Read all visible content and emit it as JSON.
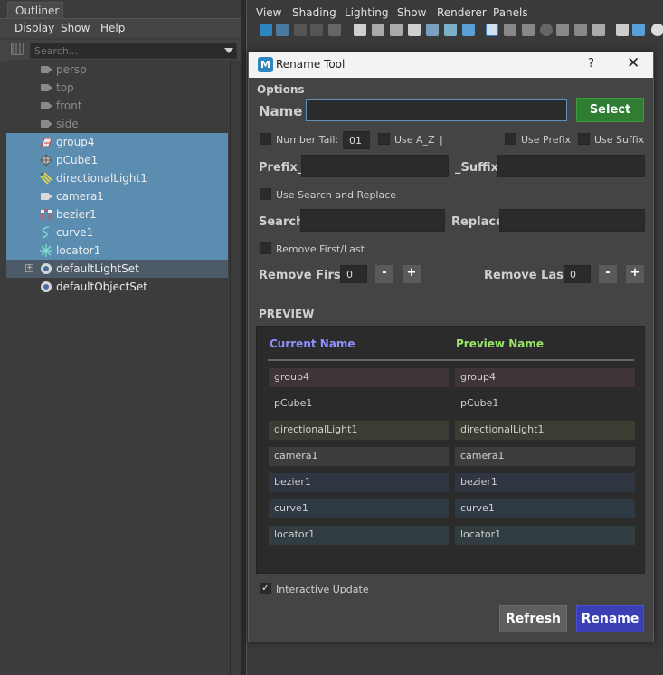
{
  "outliner": {
    "tab_label": "Outliner",
    "menu": [
      "Display",
      "Show",
      "Help"
    ],
    "search_placeholder": "Search...",
    "items": [
      {
        "label": "persp",
        "type": "camera"
      },
      {
        "label": "top",
        "type": "camera"
      },
      {
        "label": "front",
        "type": "camera"
      },
      {
        "label": "side",
        "type": "camera"
      },
      {
        "label": "group4",
        "type": "group"
      },
      {
        "label": "pCube1",
        "type": "mesh"
      },
      {
        "label": "directionalLight1",
        "type": "light"
      },
      {
        "label": "camera1",
        "type": "camera-user"
      },
      {
        "label": "bezier1",
        "type": "bezier"
      },
      {
        "label": "curve1",
        "type": "curve"
      },
      {
        "label": "locator1",
        "type": "locator"
      },
      {
        "label": "defaultLightSet",
        "type": "set"
      },
      {
        "label": "defaultObjectSet",
        "type": "set"
      }
    ]
  },
  "viewport": {
    "menu": [
      "View",
      "Shading",
      "Lighting",
      "Show",
      "Renderer",
      "Panels"
    ]
  },
  "dialog": {
    "title": "Rename Tool",
    "help": "?",
    "close": "✕",
    "options_label": "Options",
    "name_label": "Name",
    "name_value": "",
    "select_button": "Select",
    "number_tail_label": "Number Tail:",
    "number_tail_value": "01",
    "use_az_label": "Use A_Z",
    "separator": "|",
    "use_prefix_label": "Use Prefix",
    "use_suffix_label": "Use Suffix",
    "prefix_label": "Prefix_",
    "suffix_label": "_Suffix",
    "use_search_replace_label": "Use Search and Replace",
    "search_label": "Search",
    "replace_label": "Replace",
    "remove_first_last_label": "Remove First/Last",
    "remove_first_label": "Remove First:",
    "remove_first_value": "0",
    "remove_last_label": "Remove Last:",
    "remove_last_value": "0",
    "minus": "-",
    "plus": "+",
    "preview_label": "PREVIEW",
    "current_name_header": "Current Name",
    "preview_name_header": "Preview Name",
    "rows": [
      {
        "current": "group4",
        "preview": "group4",
        "color": "#3f3538"
      },
      {
        "current": "pCube1",
        "preview": "pCube1",
        "color": "#2b2b2b"
      },
      {
        "current": "directionalLight1",
        "preview": "directionalLight1",
        "color": "#3c3d32"
      },
      {
        "current": "camera1",
        "preview": "camera1",
        "color": "#3d3d3d"
      },
      {
        "current": "bezier1",
        "preview": "bezier1",
        "color": "#2f3641"
      },
      {
        "current": "curve1",
        "preview": "curve1",
        "color": "#2f3944"
      },
      {
        "current": "locator1",
        "preview": "locator1",
        "color": "#313d40"
      }
    ],
    "interactive_update_label": "Interactive Update",
    "interactive_update_checked": true,
    "refresh_button": "Refresh",
    "rename_button": "Rename",
    "colors": {
      "current_header": "#8f8fff",
      "preview_header": "#9be36a",
      "select_green": "#2e7d32",
      "rename_blue": "#3b3fb4"
    }
  }
}
